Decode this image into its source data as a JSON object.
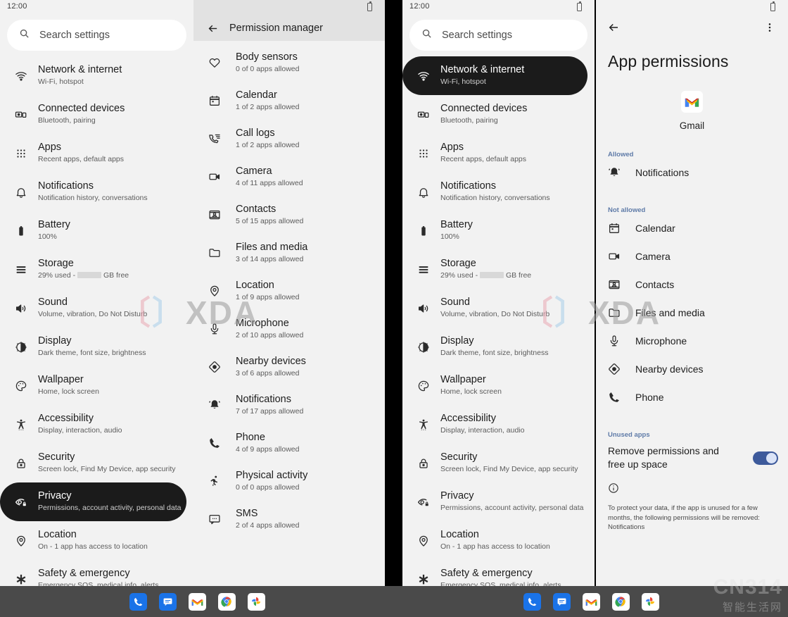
{
  "status": {
    "clock": "12:00",
    "battery_icon": "battery-icon"
  },
  "search": {
    "placeholder": "Search settings",
    "icon": "search-icon"
  },
  "settings_list": [
    {
      "icon": "wifi-icon",
      "title": "Network & internet",
      "subtitle": "Wi-Fi, hotspot"
    },
    {
      "icon": "devices-icon",
      "title": "Connected devices",
      "subtitle": "Bluetooth, pairing"
    },
    {
      "icon": "apps-grid-icon",
      "title": "Apps",
      "subtitle": "Recent apps, default apps"
    },
    {
      "icon": "bell-icon",
      "title": "Notifications",
      "subtitle": "Notification history, conversations"
    },
    {
      "icon": "battery-icon",
      "title": "Battery",
      "subtitle": "100%"
    },
    {
      "icon": "storage-icon",
      "title": "Storage",
      "subtitle": "29% used - █ GB free"
    },
    {
      "icon": "volume-icon",
      "title": "Sound",
      "subtitle": "Volume, vibration, Do Not Disturb"
    },
    {
      "icon": "brightness-icon",
      "title": "Display",
      "subtitle": "Dark theme, font size, brightness"
    },
    {
      "icon": "palette-icon",
      "title": "Wallpaper",
      "subtitle": "Home, lock screen"
    },
    {
      "icon": "accessibility-icon",
      "title": "Accessibility",
      "subtitle": "Display, interaction, audio"
    },
    {
      "icon": "lock-icon",
      "title": "Security",
      "subtitle": "Screen lock, Find My Device, app security"
    },
    {
      "icon": "eye-lock-icon",
      "title": "Privacy",
      "subtitle": "Permissions, account activity, personal data"
    },
    {
      "icon": "location-pin-icon",
      "title": "Location",
      "subtitle": "On - 1 app has access to location"
    },
    {
      "icon": "asterisk-icon",
      "title": "Safety & emergency",
      "subtitle": "Emergency SOS, medical info, alerts"
    }
  ],
  "panel1": {
    "selected_index": 11
  },
  "panel3": {
    "selected_index": 0
  },
  "storage_subtitle_prefix": "29% used - ",
  "storage_subtitle_suffix": " GB free",
  "permission_manager": {
    "title": "Permission manager",
    "back_icon": "back-arrow-icon",
    "items": [
      {
        "icon": "heart-icon",
        "title": "Body sensors",
        "subtitle": "0 of 0 apps allowed"
      },
      {
        "icon": "calendar-icon",
        "title": "Calendar",
        "subtitle": "1 of 2 apps allowed"
      },
      {
        "icon": "call-log-icon",
        "title": "Call logs",
        "subtitle": "1 of 2 apps allowed"
      },
      {
        "icon": "camera-icon",
        "title": "Camera",
        "subtitle": "4 of 11 apps allowed"
      },
      {
        "icon": "contacts-icon",
        "title": "Contacts",
        "subtitle": "5 of 15 apps allowed"
      },
      {
        "icon": "folder-icon",
        "title": "Files and media",
        "subtitle": "3 of 14 apps allowed"
      },
      {
        "icon": "location-pin-icon",
        "title": "Location",
        "subtitle": "1 of 9 apps allowed"
      },
      {
        "icon": "microphone-icon",
        "title": "Microphone",
        "subtitle": "2 of 10 apps allowed"
      },
      {
        "icon": "nearby-icon",
        "title": "Nearby devices",
        "subtitle": "3 of 6 apps allowed"
      },
      {
        "icon": "bell-ring-icon",
        "title": "Notifications",
        "subtitle": "7 of 17 apps allowed"
      },
      {
        "icon": "phone-icon",
        "title": "Phone",
        "subtitle": "4 of 9 apps allowed"
      },
      {
        "icon": "running-icon",
        "title": "Physical activity",
        "subtitle": "0 of 0 apps allowed"
      },
      {
        "icon": "sms-icon",
        "title": "SMS",
        "subtitle": "2 of 4 apps allowed"
      }
    ]
  },
  "app_permissions": {
    "back_icon": "back-arrow-icon",
    "menu_icon": "overflow-menu-icon",
    "page_title": "App permissions",
    "app_name": "Gmail",
    "app_icon": "gmail-icon",
    "allowed_label": "Allowed",
    "allowed": [
      {
        "icon": "bell-ring-icon",
        "label": "Notifications"
      }
    ],
    "not_allowed_label": "Not allowed",
    "not_allowed": [
      {
        "icon": "calendar-icon",
        "label": "Calendar"
      },
      {
        "icon": "camera-icon",
        "label": "Camera"
      },
      {
        "icon": "contacts-icon",
        "label": "Contacts"
      },
      {
        "icon": "folder-icon",
        "label": "Files and media"
      },
      {
        "icon": "microphone-icon",
        "label": "Microphone"
      },
      {
        "icon": "nearby-icon",
        "label": "Nearby devices"
      },
      {
        "icon": "phone-icon",
        "label": "Phone"
      }
    ],
    "unused_label": "Unused apps",
    "unused_toggle_text": "Remove permissions and free up space",
    "unused_toggle_on": true,
    "info_icon": "info-icon",
    "footnote": "To protect your data, if the app is unused for a few months, the following permissions will be removed: Notifications",
    "toggle_color": "#3d5a9b"
  },
  "taskbar": {
    "apps": [
      {
        "name": "phone-app-icon",
        "label": "Phone"
      },
      {
        "name": "messages-app-icon",
        "label": "Messages"
      },
      {
        "name": "gmail-app-icon",
        "label": "Gmail"
      },
      {
        "name": "chrome-app-icon",
        "label": "Chrome"
      },
      {
        "name": "photos-app-icon",
        "label": "Photos"
      }
    ]
  },
  "watermarks": {
    "xda": "XDA",
    "cn_big": "CN314",
    "cn_small": "智能生活网"
  }
}
